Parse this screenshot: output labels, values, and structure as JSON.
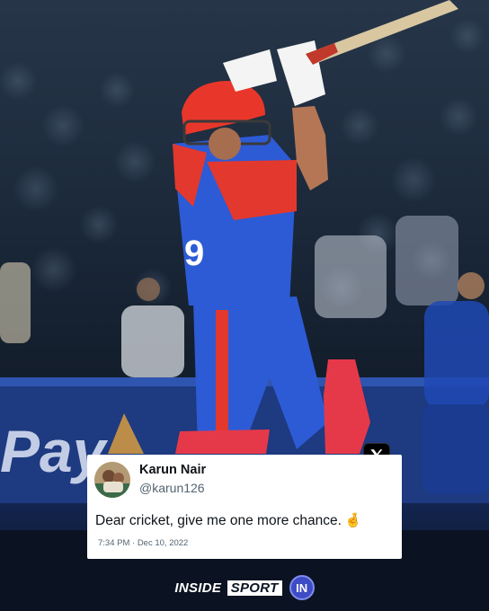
{
  "tweet": {
    "display_name": "Karun Nair",
    "handle": "@karun126",
    "text": "Dear cricket, give me one more chance.",
    "emoji_icon": "crossed-fingers-icon",
    "timestamp": "7:34 PM · Dec 10, 2022"
  },
  "x_badge_icon": "x-logo-icon",
  "brand": {
    "name_part1": "INSIDE",
    "name_part2": "SPORT",
    "logo_text": "IN"
  },
  "scene": {
    "jersey_number": "9",
    "sponsor_text": "Pay",
    "colors": {
      "jersey_blue": "#2d5bd6",
      "jersey_red": "#e3382d",
      "helmet_red": "#e8372a",
      "crowd_dark": "#1c2a3c"
    }
  }
}
